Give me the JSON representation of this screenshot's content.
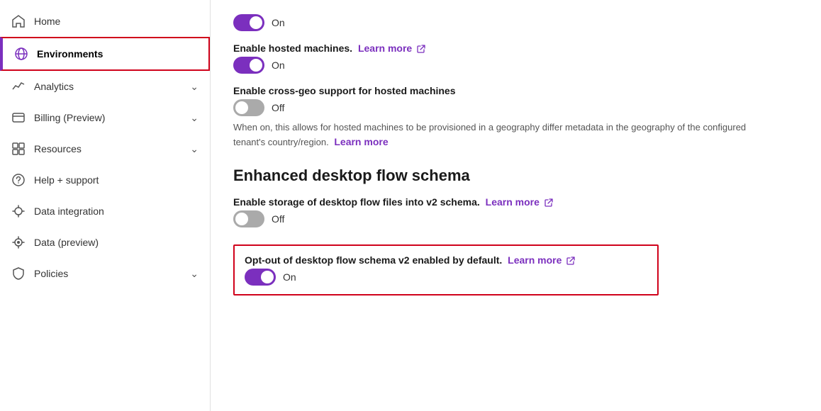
{
  "sidebar": {
    "items": [
      {
        "id": "home",
        "label": "Home",
        "icon": "home",
        "active": false,
        "hasChevron": false
      },
      {
        "id": "environments",
        "label": "Environments",
        "icon": "globe",
        "active": true,
        "hasChevron": false
      },
      {
        "id": "analytics",
        "label": "Analytics",
        "icon": "chart",
        "active": false,
        "hasChevron": true
      },
      {
        "id": "billing",
        "label": "Billing (Preview)",
        "icon": "billing",
        "active": false,
        "hasChevron": true
      },
      {
        "id": "resources",
        "label": "Resources",
        "icon": "resources",
        "active": false,
        "hasChevron": true
      },
      {
        "id": "help",
        "label": "Help + support",
        "icon": "help",
        "active": false,
        "hasChevron": false
      },
      {
        "id": "data-integration",
        "label": "Data integration",
        "icon": "data-integration",
        "active": false,
        "hasChevron": false
      },
      {
        "id": "data-preview",
        "label": "Data (preview)",
        "icon": "data-preview",
        "active": false,
        "hasChevron": false
      },
      {
        "id": "policies",
        "label": "Policies",
        "icon": "policies",
        "active": false,
        "hasChevron": true
      }
    ]
  },
  "main": {
    "top_toggle": {
      "state": "on",
      "label": "On"
    },
    "hosted_machines": {
      "setting_label": "Enable hosted machines.",
      "learn_more_text": "Learn more",
      "toggle_state": "on",
      "toggle_label": "On"
    },
    "cross_geo": {
      "setting_label": "Enable cross-geo support for hosted machines",
      "toggle_state": "off",
      "toggle_label": "Off",
      "description": "When on, this allows for hosted machines to be provisioned in a geography differ metadata in the geography of the configured tenant's country/region.",
      "learn_more_text": "Learn more"
    },
    "enhanced_schema": {
      "section_title": "Enhanced desktop flow schema",
      "storage_setting": {
        "label": "Enable storage of desktop flow files into v2 schema.",
        "learn_more_text": "Learn more",
        "toggle_state": "off",
        "toggle_label": "Off"
      },
      "opt_out_setting": {
        "label": "Opt-out of desktop flow schema v2 enabled by default.",
        "learn_more_text": "Learn more",
        "toggle_state": "on",
        "toggle_label": "On"
      }
    }
  }
}
